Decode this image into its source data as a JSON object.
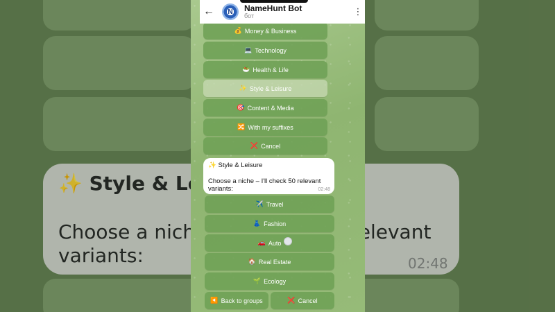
{
  "background": {
    "bubble_title": "Style & Leisure",
    "bubble_line1": "Choose a niche – I'll check 50 relevant",
    "bubble_line2": "variants:",
    "time": "02:48"
  },
  "header": {
    "back_icon": "arrow-left-icon",
    "title": "NameHunt Bot",
    "subtitle": "бот",
    "menu_icon": "kebab-menu-icon"
  },
  "group_buttons": [
    {
      "icon": "💰",
      "label": "Money & Business"
    },
    {
      "icon": "💻",
      "label": "Technology"
    },
    {
      "icon": "🥗",
      "label": "Health & Life"
    },
    {
      "icon": "✨",
      "label": "Style & Leisure"
    },
    {
      "icon": "🎯",
      "label": "Content & Media"
    },
    {
      "icon": "🔀",
      "label": "With my suffixes"
    },
    {
      "icon": "❌",
      "label": "Cancel"
    }
  ],
  "message": {
    "title_icon": "✨",
    "title": "Style & Leisure",
    "text": "Choose a niche – I'll check 50 relevant variants:",
    "time": "02:48"
  },
  "niche_buttons": [
    {
      "icon": "✈️",
      "label": "Travel"
    },
    {
      "icon": "👗",
      "label": "Fashion"
    },
    {
      "icon": "🚗",
      "label": "Auto"
    },
    {
      "icon": "🏠",
      "label": "Real Estate"
    },
    {
      "icon": "🌱",
      "label": "Ecology"
    }
  ],
  "bottom_buttons": {
    "back": {
      "icon": "◀️",
      "label": "Back to groups"
    },
    "cancel": {
      "icon": "❌",
      "label": "Cancel"
    }
  }
}
